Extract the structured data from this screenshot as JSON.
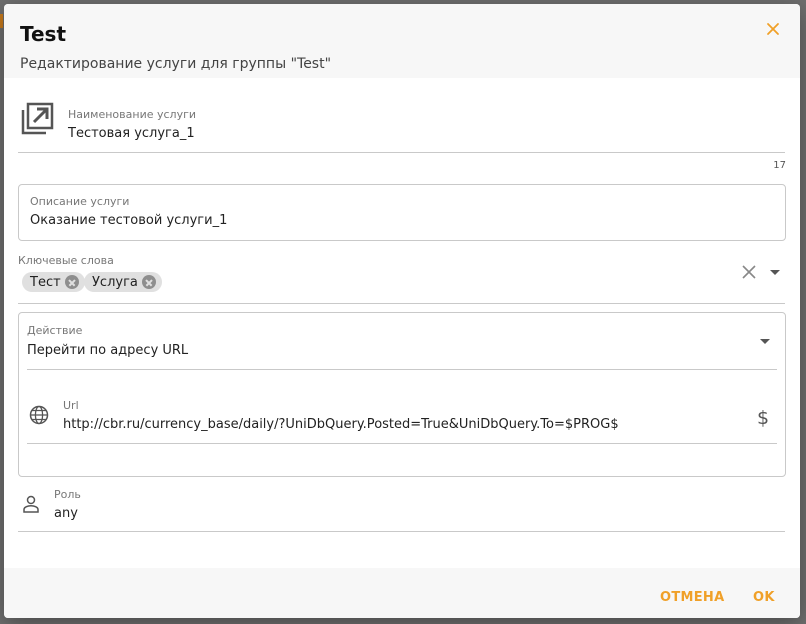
{
  "dialog": {
    "title": "Test",
    "subtitle": "Редактирование услуги для группы \"Test\""
  },
  "name_field": {
    "label": "Наименование услуги",
    "value": "Тестовая услуга_1",
    "counter": "17"
  },
  "description_field": {
    "label": "Описание услуги",
    "value": "Оказание тестовой услуги_1"
  },
  "keywords_field": {
    "label": "Ключевые слова",
    "chips": [
      {
        "label": "Тест"
      },
      {
        "label": "Услуга"
      }
    ]
  },
  "action_field": {
    "label": "Действие",
    "value": "Перейти по адресу URL"
  },
  "url_field": {
    "label": "Url",
    "value": "http://cbr.ru/currency_base/daily/?UniDbQuery.Posted=True&UniDbQuery.To=$PROG$",
    "variable_symbol": "$"
  },
  "role_field": {
    "label": "Роль",
    "value": "any"
  },
  "footer": {
    "cancel_label": "ОТМЕНА",
    "ok_label": "OK"
  },
  "colors": {
    "accent": "#f0a028",
    "header_bg": "#f7f7f7",
    "body_bg": "#ffffff",
    "backdrop": "#6f6f6f"
  },
  "icons": {
    "close": "close-icon",
    "service": "open-in-new-icon",
    "globe": "globe-icon",
    "role": "person-icon",
    "clear": "clear-icon",
    "dropdown": "chevron-down-icon"
  }
}
